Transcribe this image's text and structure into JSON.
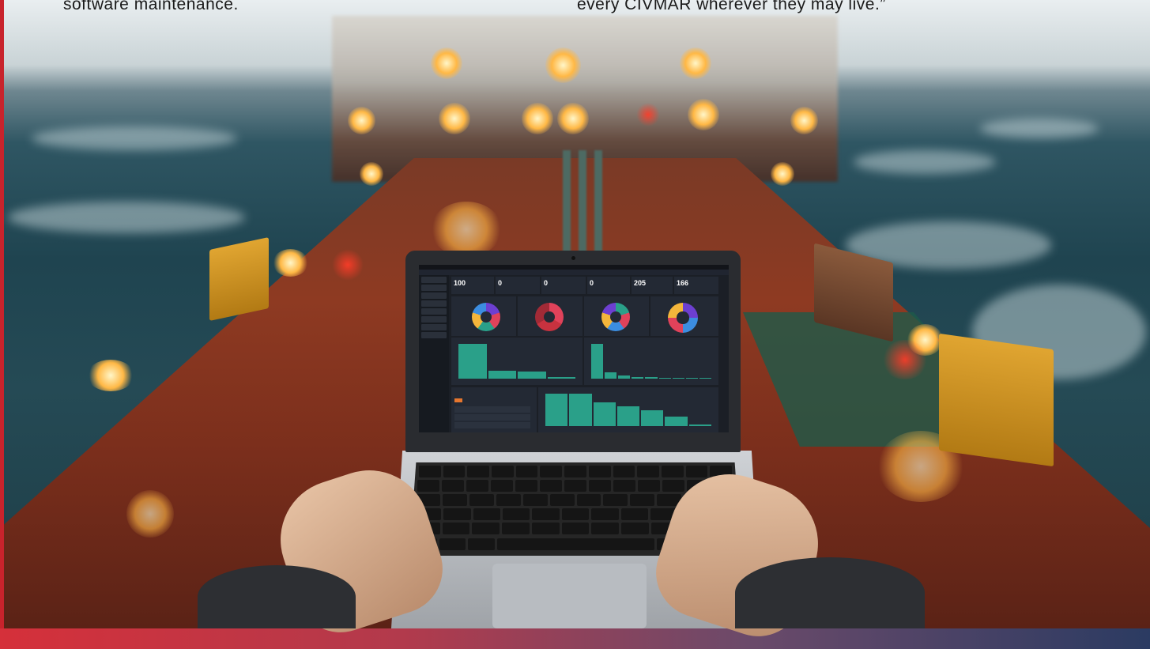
{
  "caption": {
    "left_text": "software maintenance.",
    "right_text": "every CIVMAR wherever they may live.”"
  },
  "dashboard": {
    "kpis": [
      {
        "value": "100"
      },
      {
        "value": "0"
      },
      {
        "value": "0"
      },
      {
        "value": "0"
      },
      {
        "value": "205"
      },
      {
        "value": "166"
      }
    ],
    "donut_colors": [
      [
        "#6d3fd1",
        "#e0425a",
        "#2aa089",
        "#f4b63b",
        "#3c8de0"
      ],
      [
        "#e0425a",
        "#c8323f",
        "#a22a36"
      ],
      [
        "#2aa089",
        "#e0425a",
        "#3c8de0",
        "#f4b63b",
        "#6d3fd1"
      ],
      [
        "#6d3fd1",
        "#3c8de0",
        "#e0425a",
        "#f4b63b"
      ]
    ],
    "bar_chart_1": [
      1.0,
      0.22,
      0.2,
      0.05
    ],
    "bar_chart_2": [
      1.0,
      0.18,
      0.08,
      0.05,
      0.04,
      0.03,
      0.03,
      0.02,
      0.02
    ],
    "bar_chart_3": [
      1.0,
      1.0,
      0.72,
      0.6,
      0.5,
      0.3,
      0.05
    ]
  },
  "colors": {
    "accent_red": "#c8232c",
    "bar_green": "#2aa089"
  }
}
